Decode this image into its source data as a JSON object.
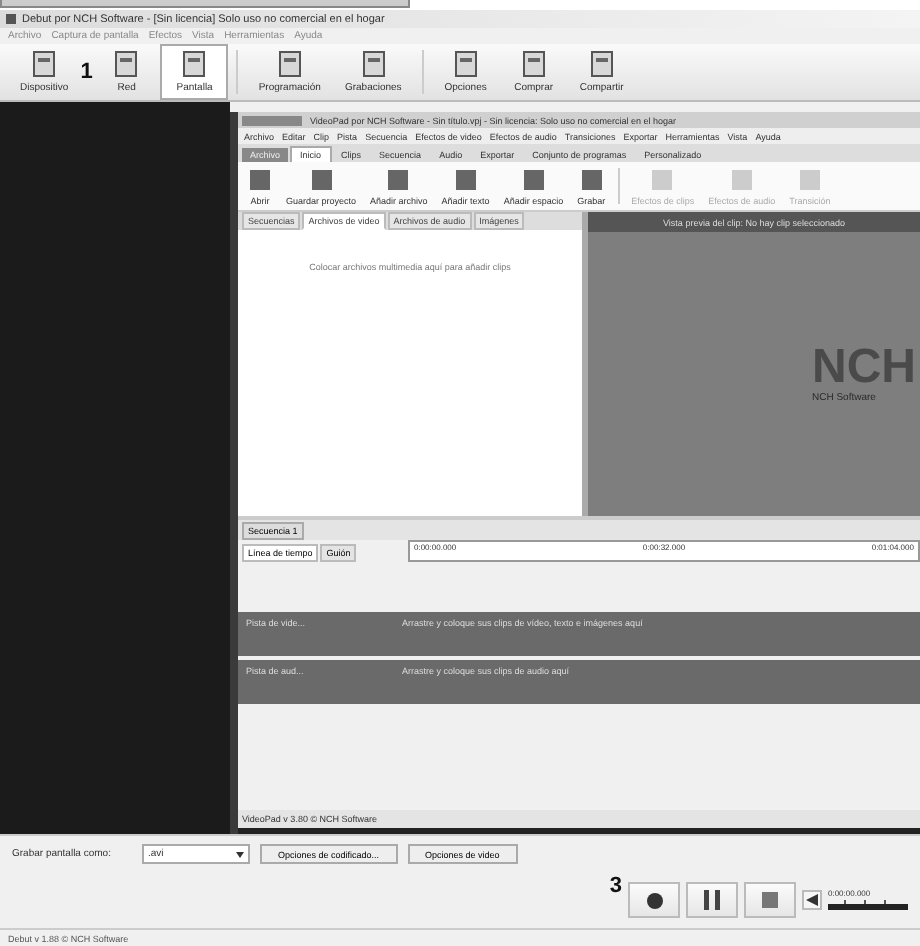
{
  "window": {
    "title": "Debut por NCH Software - [Sin licencia] Solo uso no comercial en el hogar"
  },
  "menu": [
    "Archivo",
    "Captura de pantalla",
    "Efectos",
    "Vista",
    "Herramientas",
    "Ayuda"
  ],
  "toolbar": [
    {
      "label": "Dispositivo",
      "selected": false
    },
    {
      "label": "Red",
      "selected": false,
      "marker": "1"
    },
    {
      "label": "Pantalla",
      "selected": true
    },
    {
      "label": "Programación",
      "selected": false
    },
    {
      "label": "Grabaciones",
      "selected": false
    },
    {
      "label": "Opciones",
      "selected": false
    },
    {
      "label": "Comprar",
      "selected": false
    },
    {
      "label": "Compartir",
      "selected": false
    }
  ],
  "captured_window": {
    "title": "VideoPad por NCH Software - Sin título.vpj - Sin licencia: Solo uso no comercial en el hogar",
    "menu": [
      "Archivo",
      "Editar",
      "Clip",
      "Pista",
      "Secuencia",
      "Efectos de video",
      "Efectos de audio",
      "Transiciones",
      "Exportar",
      "Herramientas",
      "Vista",
      "Ayuda"
    ],
    "tabs": [
      {
        "label": "Archivo",
        "selected": false
      },
      {
        "label": "Inicio",
        "selected": true
      },
      {
        "label": "Clips",
        "selected": false
      },
      {
        "label": "Secuencia",
        "selected": false
      },
      {
        "label": "Audio",
        "selected": false
      },
      {
        "label": "Exportar",
        "selected": false
      },
      {
        "label": "Conjunto de programas",
        "selected": false
      },
      {
        "label": "Personalizado",
        "selected": false
      }
    ],
    "ribbon": [
      {
        "label": "Abrir",
        "disabled": false
      },
      {
        "label": "Guardar proyecto",
        "disabled": false
      },
      {
        "label": "Añadir archivo",
        "disabled": false
      },
      {
        "label": "Añadir texto",
        "disabled": false
      },
      {
        "label": "Añadir espacio",
        "disabled": false
      },
      {
        "label": "Grabar",
        "disabled": false
      },
      {
        "label": "Efectos de clips",
        "disabled": true
      },
      {
        "label": "Efectos de audio",
        "disabled": true
      },
      {
        "label": "Transición",
        "disabled": true
      }
    ],
    "bin_tabs": [
      {
        "label": "Secuencias",
        "selected": false
      },
      {
        "label": "Archivos de video",
        "selected": true
      },
      {
        "label": "Archivos de audio",
        "selected": false
      },
      {
        "label": "Imágenes",
        "selected": false
      }
    ],
    "bin_hint": "Colocar archivos multimedia aquí para añadir clips",
    "preview_title": "Vista previa del clip: No hay clip seleccionado",
    "logo": {
      "text": "NCH",
      "subtitle": "NCH Software"
    },
    "sequence_tab": "Secuencia 1",
    "timeline_tabs": [
      {
        "label": "Línea de tiempo",
        "selected": true
      },
      {
        "label": "Guión",
        "selected": false
      }
    ],
    "ruler": [
      "0:00:00.000",
      "0:00:32.000",
      "0:01:04.000"
    ],
    "tracks": [
      {
        "name": "Pista de vide...",
        "hint": "Arrastre y coloque sus clips de vídeo, texto e imágenes aquí"
      },
      {
        "name": "Pista de aud...",
        "hint": "Arrastre y coloque sus clips de audio aquí"
      }
    ],
    "status": "VideoPad v 3.80 © NCH Software"
  },
  "output": {
    "label": "Grabar pantalla como:",
    "format": ".avi",
    "buttons": [
      "Opciones de codificado...",
      "Opciones de video"
    ]
  },
  "controls": {
    "marker": "3",
    "time": "0:00:00.000"
  },
  "status_bar": "Debut v 1.88 © NCH Software"
}
